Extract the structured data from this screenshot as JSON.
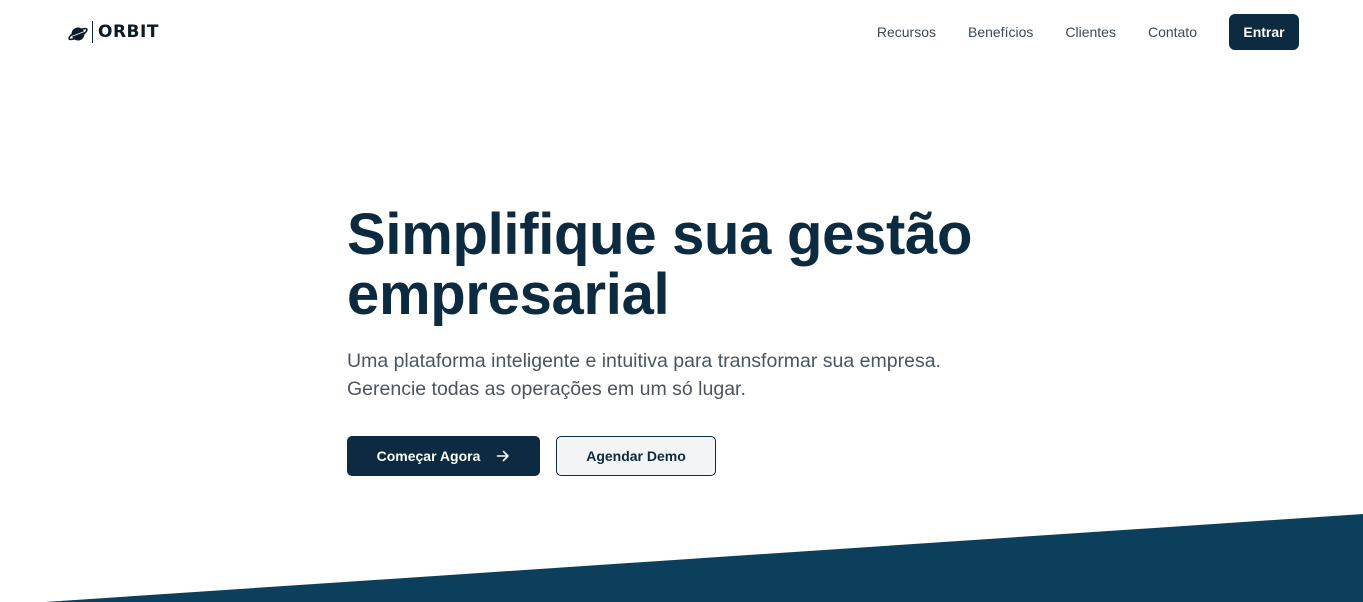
{
  "brand": {
    "name": "ORBIT",
    "icon": "planet-icon"
  },
  "nav": {
    "links": [
      {
        "label": "Recursos"
      },
      {
        "label": "Benefícios"
      },
      {
        "label": "Clientes"
      },
      {
        "label": "Contato"
      }
    ],
    "login_label": "Entrar"
  },
  "hero": {
    "title": "Simplifique sua gestão empresarial",
    "subtitle": "Uma plataforma inteligente e intuitiva para transformar sua empresa. Gerencie todas as operações em um só lugar.",
    "primary_cta": "Começar Agora",
    "primary_cta_icon": "arrow-right-icon",
    "secondary_cta": "Agendar Demo"
  },
  "colors": {
    "primary": "#0c2a40",
    "wedge": "#0b3f5c",
    "text_muted": "#4a5560",
    "background": "#ffffff"
  }
}
